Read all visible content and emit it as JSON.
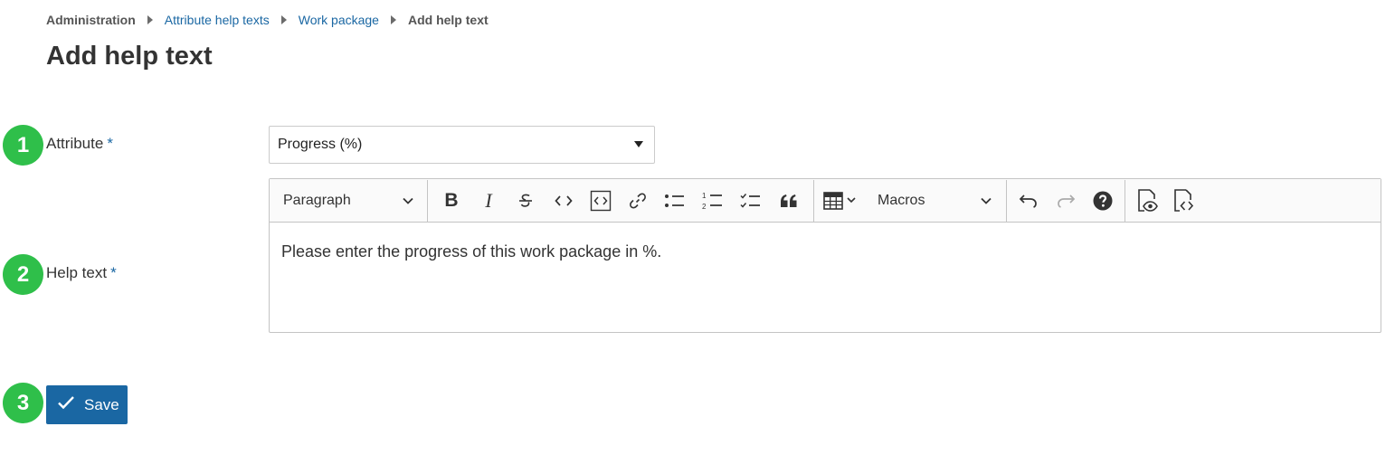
{
  "breadcrumb": {
    "items": [
      "Administration",
      "Attribute help texts",
      "Work package",
      "Add help text"
    ]
  },
  "page": {
    "title": "Add help text"
  },
  "markers": [
    "1",
    "2",
    "3"
  ],
  "form": {
    "attribute_label": "Attribute",
    "required_mark": "*",
    "attribute_value": "Progress (%)",
    "help_text_label": "Help text",
    "help_text_value": "Please enter the progress of this work package in %."
  },
  "toolbar": {
    "paragraph_label": "Paragraph",
    "macros_label": "Macros",
    "buttons": [
      "bold-icon",
      "italic-icon",
      "strikethrough-icon",
      "inline-code-icon",
      "code-block-icon",
      "link-icon",
      "bulleted-list-icon",
      "numbered-list-icon",
      "todo-list-icon",
      "quote-icon",
      "table-icon",
      "undo-icon",
      "redo-icon",
      "help-icon",
      "preview-icon",
      "source-icon"
    ]
  },
  "actions": {
    "save_label": "Save"
  },
  "colors": {
    "accent": "#1a67a3",
    "marker": "#2fbf4a"
  }
}
